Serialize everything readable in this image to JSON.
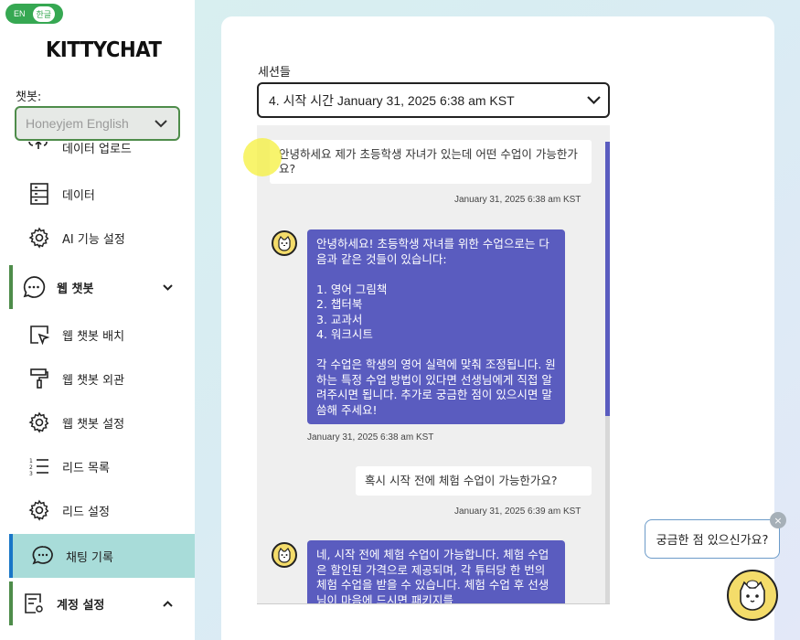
{
  "lang": {
    "en": "EN",
    "ko": "한글"
  },
  "brand": {
    "logo": "KITTYCHAT"
  },
  "sidebar": {
    "chatbot_label": "챗봇:",
    "chatbot_selected": "Honeyjem English",
    "partial_item": "데이터 업로드",
    "items": [
      {
        "label": "데이터",
        "icon": "server-icon"
      },
      {
        "label": "AI 기능 설정",
        "icon": "gear-icon"
      },
      {
        "label": "웹 챗봇",
        "icon": "chat-bubble-icon",
        "group": true
      },
      {
        "label": "웹 챗봇 배치",
        "icon": "placement-icon"
      },
      {
        "label": "웹 챗봇 외관",
        "icon": "paint-roller-icon"
      },
      {
        "label": "웹 챗봇 설정",
        "icon": "gear-icon"
      },
      {
        "label": "리드 목록",
        "icon": "list-icon"
      },
      {
        "label": "리드 설정",
        "icon": "gear-icon"
      },
      {
        "label": "채팅 기록",
        "icon": "chat-history-icon",
        "active": true
      },
      {
        "label": "계정 설정",
        "icon": "account-settings-icon",
        "group": true
      }
    ]
  },
  "main": {
    "sessions_label": "세션들",
    "session_selected": "4. 시작 시간 January 31, 2025 6:38 am KST",
    "messages": [
      {
        "role": "user",
        "text": "안녕하세요 제가 초등학생 자녀가 있는데 어떤 수업이 가능한가요?",
        "time": "January 31, 2025 6:38 am KST"
      },
      {
        "role": "bot",
        "text": "안녕하세요! 초등학생 자녀를 위한 수업으로는 다음과 같은 것들이 있습니다:\n\n1. 영어 그림책\n2. 챕터북\n3. 교과서\n4. 워크시트\n\n각 수업은 학생의 영어 실력에 맞춰 조정됩니다. 원하는 특정 수업 방법이 있다면 선생님에게 직접 알려주시면 됩니다. 추가로 궁금한 점이 있으시면 말씀해 주세요!",
        "time": "January 31, 2025 6:38 am KST"
      },
      {
        "role": "user",
        "text": "혹시 시작 전에 체험 수업이 가능한가요?",
        "time": "January 31, 2025 6:39 am KST"
      },
      {
        "role": "bot",
        "text": "네, 시작 전에 체험 수업이 가능합니다. 체험 수업은 할인된 가격으로 제공되며, 각 튜터당 한 번의 체험 수업을 받을 수 있습니다. 체험 수업 후 선생님이 마음에 드시면 패키지를",
        "time": ""
      }
    ]
  },
  "widget": {
    "tooltip": "궁금한 점 있으신가요?",
    "close": "×"
  }
}
